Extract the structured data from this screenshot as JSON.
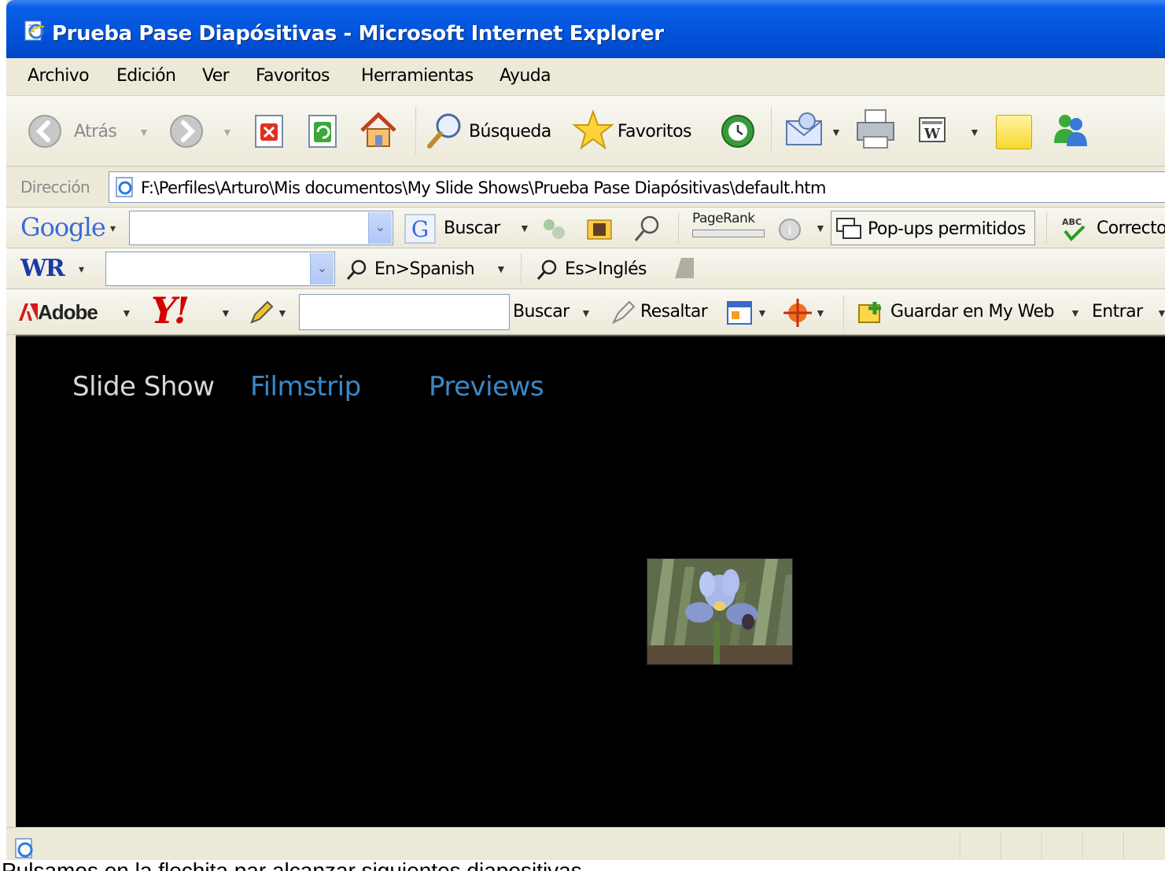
{
  "window": {
    "title": "Prueba Pase Diapósitivas - Microsoft Internet Explorer"
  },
  "menu": [
    "Archivo",
    "Edición",
    "Ver",
    "Favoritos",
    "Herramientas",
    "Ayuda"
  ],
  "standard_toolbar": {
    "back_label": "Atrás",
    "search_label": "Búsqueda",
    "favorites_label": "Favoritos"
  },
  "address_bar": {
    "label": "Dirección",
    "url": "F:\\Perfiles\\Arturo\\Mis documentos\\My Slide Shows\\Prueba  Pase Diapósitivas\\default.htm"
  },
  "google_toolbar": {
    "logo": "Google",
    "search_value": "",
    "search_button": "Buscar",
    "pagerank_label": "PageRank",
    "popups_label": "Pop-ups permitidos",
    "spellcheck_label": "Correcto"
  },
  "wr_toolbar": {
    "logo": "WR",
    "search_value": "",
    "en_spanish": "En>Spanish",
    "es_ingles": "Es>Inglés"
  },
  "yahoo_toolbar": {
    "adobe_label": "Adobe",
    "yahoo_logo": "Y!",
    "search_value": "",
    "search_button": "Buscar",
    "highlight_label": "Resaltar",
    "save_myweb_label": "Guardar en My Web",
    "signin_label": "Entrar"
  },
  "page": {
    "nav": {
      "slideshow": "Slide Show",
      "filmstrip": "Filmstrip",
      "previews": "Previews"
    },
    "background_color": "#000000",
    "active_nav_color": "#d8d8d8",
    "link_color": "#3a88c8"
  },
  "caption": "Pulsamos en la flechita par alcanzar siguientes diapositivas"
}
